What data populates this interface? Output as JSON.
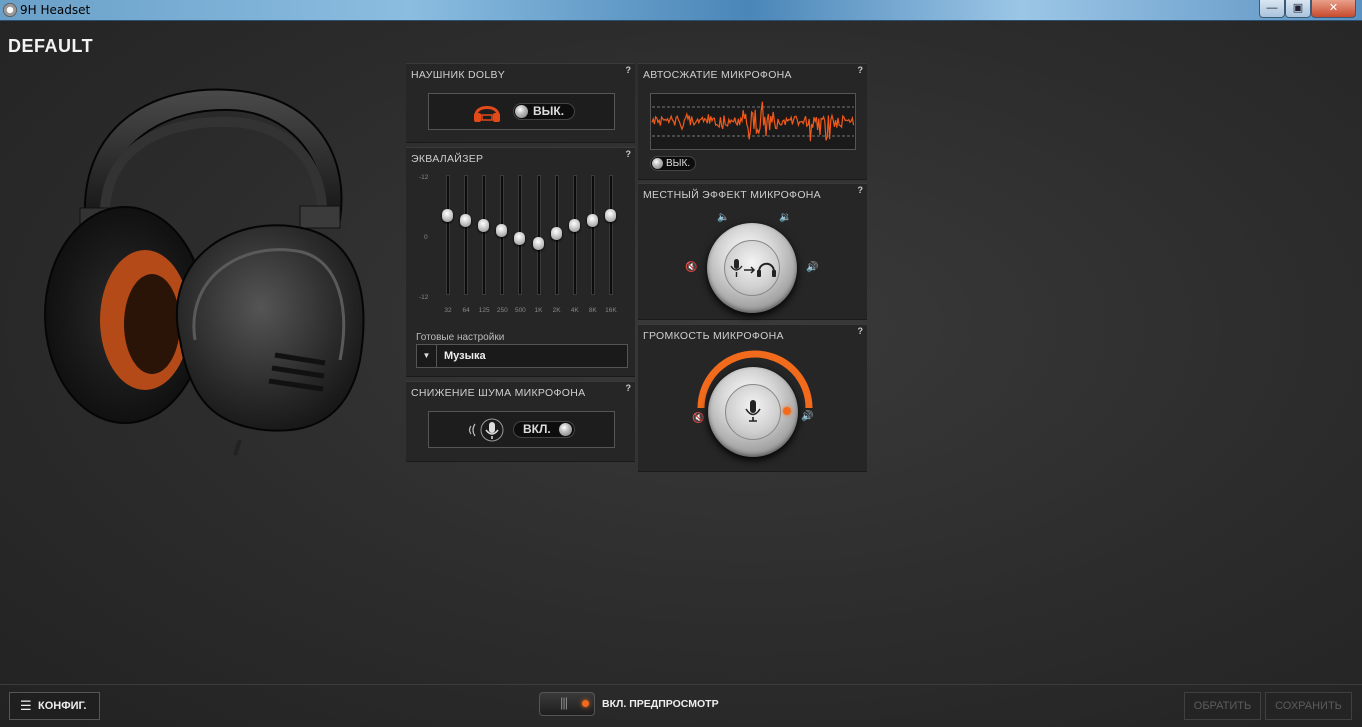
{
  "window": {
    "title": "9H Headset",
    "controls": {
      "minimize": "—",
      "maximize": "▣",
      "close": "✕"
    }
  },
  "profile": {
    "name": "DEFAULT"
  },
  "dolby": {
    "title": "НАУШНИК DOLBY",
    "help": "?",
    "toggle_label": "ВЫК.",
    "enabled": false
  },
  "equalizer": {
    "title": "ЭКВАЛАЙЗЕР",
    "help": "?",
    "db_labels": {
      "top": "-12",
      "mid": "0",
      "bottom": "-12"
    },
    "bands": [
      {
        "freq": "32",
        "gain": 4
      },
      {
        "freq": "64",
        "gain": 3
      },
      {
        "freq": "125",
        "gain": 2
      },
      {
        "freq": "250",
        "gain": 1
      },
      {
        "freq": "500",
        "gain": -0.5
      },
      {
        "freq": "1K",
        "gain": -1.5
      },
      {
        "freq": "2K",
        "gain": 0.5
      },
      {
        "freq": "4K",
        "gain": 2
      },
      {
        "freq": "8K",
        "gain": 3
      },
      {
        "freq": "16K",
        "gain": 4
      }
    ],
    "preset_label": "Готовые настройки",
    "preset_value": "Музыка"
  },
  "noise_reduction": {
    "title": "СНИЖЕНИЕ ШУМА МИКРОФОНА",
    "help": "?",
    "toggle_label": "ВКЛ.",
    "enabled": true
  },
  "auto_compression": {
    "title": "АВТОСЖАТИЕ МИКРОФОНА",
    "help": "?",
    "toggle_label": "ВЫК.",
    "enabled": false
  },
  "sidetone": {
    "title": "МЕСТНЫЙ ЭФФЕКТ МИКРОФОНА",
    "help": "?",
    "level": 0
  },
  "mic_volume": {
    "title": "ГРОМКОСТЬ МИКРОФОНА",
    "help": "?",
    "level": 1.0
  },
  "footer": {
    "config_label": "КОНФИГ.",
    "preview_label": "ВКЛ. ПРЕДПРОСМОТР",
    "revert_label": "ОБРАТИТЬ",
    "save_label": "СОХРАНИТЬ"
  },
  "colors": {
    "accent": "#f26b1d",
    "panel": "#262626",
    "background": "#2c2c2c"
  }
}
